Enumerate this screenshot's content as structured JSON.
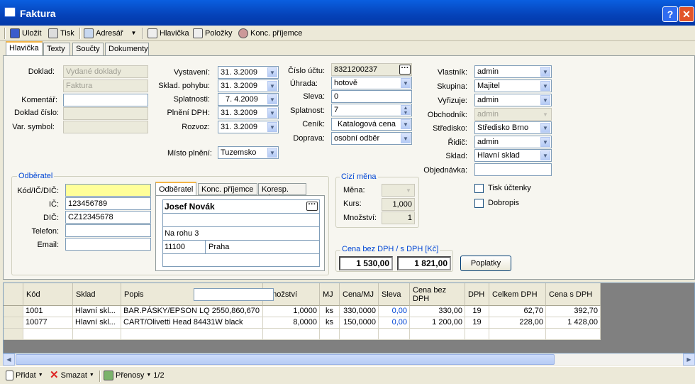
{
  "window": {
    "title": "Faktura",
    "help_label": "?",
    "close_label": "✕"
  },
  "toolbar": {
    "save": "Uložit",
    "print": "Tisk",
    "address": "Adresář",
    "header": "Hlavička",
    "items": "Položky",
    "recipient": "Konc. příjemce"
  },
  "tabs": [
    "Hlavička",
    "Texty",
    "Součty",
    "Dokumenty"
  ],
  "doc": {
    "doklad_label": "Doklad:",
    "doklad1": "Vydané doklady",
    "doklad2": "Faktura",
    "komentar_label": "Komentář:",
    "cislo_label": "Doklad číslo:",
    "var_label": "Var. symbol:"
  },
  "dates": {
    "vystaveni_label": "Vystavení:",
    "vystaveni": "31. 3.2009",
    "sklad_label": "Sklad. pohybu:",
    "sklad": "31. 3.2009",
    "splatnost_label": "Splatnosti:",
    "splatnost": "7. 4.2009",
    "plneni_label": "Plnění DPH:",
    "plneni": "31. 3.2009",
    "rozvoz_label": "Rozvoz:",
    "rozvoz": "31. 3.2009",
    "misto_label": "Místo plnění:",
    "misto": "Tuzemsko"
  },
  "pay": {
    "ucet_label": "Číslo účtu:",
    "ucet": "8321200237",
    "uhrada_label": "Úhrada:",
    "uhrada": "hotově",
    "sleva_label": "Sleva:",
    "sleva": "0",
    "spl_label": "Splatnost:",
    "spl": "7",
    "cenik_label": "Ceník:",
    "cenik": "Katalogová cena",
    "doprava_label": "Doprava:",
    "doprava": "osobní odběr"
  },
  "owner": {
    "vlastnik_label": "Vlastník:",
    "vlastnik": "admin",
    "skupina_label": "Skupina:",
    "skupina": "Majitel",
    "vyrizuje_label": "Vyřizuje:",
    "vyrizuje": "admin",
    "obchodnik_label": "Obchodník:",
    "obchodnik": "admin",
    "stredisko_label": "Středisko:",
    "stredisko": "Středisko Brno",
    "ridic_label": "Řidič:",
    "ridic": "admin",
    "sklad_label": "Sklad:",
    "sklad": "Hlavní sklad",
    "objednavka_label": "Objednávka:",
    "tisk": "Tisk účtenky",
    "dobropis": "Dobropis"
  },
  "customer": {
    "title": "Odběratel",
    "kod_label": "Kód/IČ/DIČ:",
    "ic_label": "IČ:",
    "ic": "123456789",
    "dic_label": "DIČ:",
    "dic": "CZ12345678",
    "tel_label": "Telefon:",
    "email_label": "Email:",
    "tabs": [
      "Odběratel",
      "Konc. příjemce",
      "Koresp. adr."
    ],
    "name": "Josef Novák",
    "street": "Na rohu 3",
    "zip": "11100",
    "city": "Praha"
  },
  "currency": {
    "title": "Cizí měna",
    "mena_label": "Měna:",
    "kurs_label": "Kurs:",
    "kurs": "1,000",
    "mnozstvi_label": "Množství:",
    "mnozstvi": "1"
  },
  "price": {
    "title": "Cena bez DPH / s DPH [Kč]",
    "bez": "1 530,00",
    "s": "1 821,00",
    "button": "Poplatky"
  },
  "grid": {
    "headers": [
      "Kód",
      "Sklad",
      "Popis",
      "Množství",
      "MJ",
      "Cena/MJ",
      "Sleva",
      "Cena bez DPH",
      "DPH",
      "Celkem DPH",
      "Cena s DPH"
    ],
    "rows": [
      [
        "1001",
        "Hlavní skl...",
        "BAR.PÁSKY/EPSON LQ 2550,860,670",
        "1,0000",
        "ks",
        "330,0000",
        "0,00",
        "330,00",
        "19",
        "62,70",
        "392,70"
      ],
      [
        "10077",
        "Hlavní skl...",
        "CART/Olivetti Head 84431W black",
        "8,0000",
        "ks",
        "150,0000",
        "0,00",
        "1 200,00",
        "19",
        "228,00",
        "1 428,00"
      ]
    ]
  },
  "status": {
    "add": "Přidat",
    "delete": "Smazat",
    "transfers": "Přenosy",
    "page": "1/2"
  },
  "colors": {
    "title_blue": "#0542b8",
    "accent_yellow": "#ffff99",
    "link_blue": "#0046d5"
  }
}
